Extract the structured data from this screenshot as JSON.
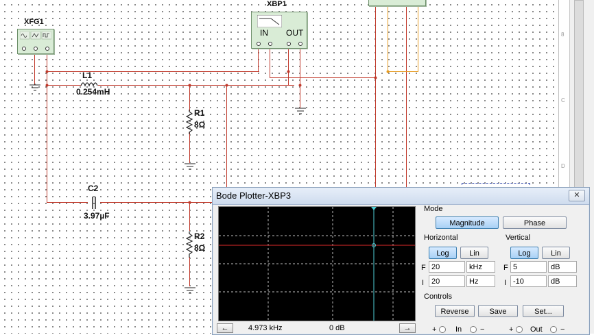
{
  "schematic": {
    "xfg1_label": "XFG1",
    "xbp1_label": "XBP1",
    "xbp1_in": "IN",
    "xbp1_out": "OUT",
    "l1_label": "L1",
    "l1_value": "0.254mH",
    "r1_label": "R1",
    "r1_value": "8Ω",
    "c2_label": "C2",
    "c2_value": "3.97µF",
    "r2_label": "R2",
    "r2_value": "8Ω",
    "ruler_marks": [
      "8",
      "C",
      "D"
    ]
  },
  "bode": {
    "title": "Bode Plotter-XBP3",
    "close_label": "✕",
    "mode": {
      "label": "Mode",
      "magnitude": "Magnitude",
      "phase": "Phase",
      "selected": "Magnitude"
    },
    "horizontal": {
      "label": "Horizontal",
      "log": "Log",
      "lin": "Lin",
      "selected": "Log",
      "f_label": "F",
      "f_value": "20",
      "f_unit": "kHz",
      "i_label": "I",
      "i_value": "20",
      "i_unit": "Hz"
    },
    "vertical": {
      "label": "Vertical",
      "log": "Log",
      "lin": "Lin",
      "selected": "Log",
      "f_label": "F",
      "f_value": "5",
      "f_unit": "dB",
      "i_label": "I",
      "i_value": "-10",
      "i_unit": "dB"
    },
    "controls": {
      "label": "Controls",
      "reverse": "Reverse",
      "save": "Save",
      "set": "Set..."
    },
    "readout_freq": "4.973 kHz",
    "readout_gain": "0 dB",
    "left_arrow": "←",
    "right_arrow": "→",
    "in_label": "In",
    "out_label": "Out",
    "plus": "+",
    "minus": "−",
    "colors": {
      "trace": "#b22222",
      "cursor": "#4fd0d8",
      "wire_red": "#c0392b",
      "wire_orange": "#e69a1e"
    }
  }
}
